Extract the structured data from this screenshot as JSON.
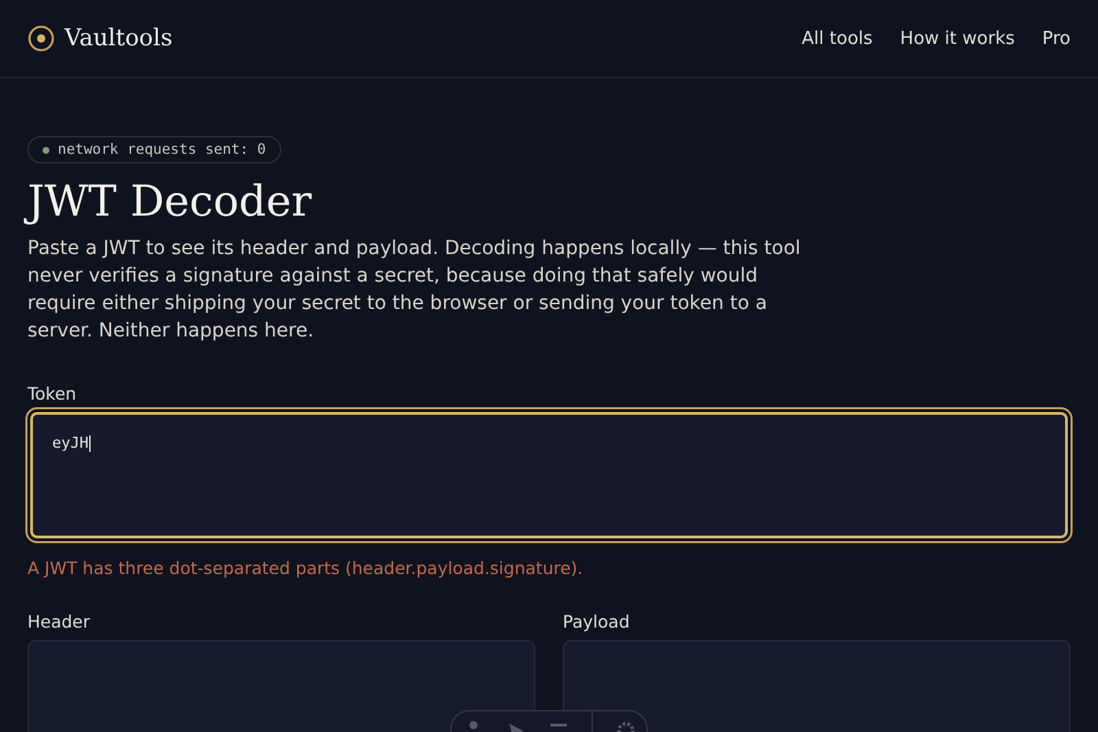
{
  "brand": {
    "name": "Vaultools"
  },
  "nav": [
    "All tools",
    "How it works",
    "Pro"
  ],
  "badge": {
    "text": "network requests sent: 0"
  },
  "title": "JWT Decoder",
  "intro": "Paste a JWT to see its header and payload. Decoding happens locally — this tool never verifies a signature against a secret, because doing that safely would require either shipping your secret to the browser or sending your token to a server. Neither happens here.",
  "token": {
    "label": "Token",
    "value": "eyJH",
    "focused": true
  },
  "error": "A JWT has three dot-separated parts (header.payload.signature).",
  "panels": [
    {
      "label": "Header"
    },
    {
      "label": "Payload"
    }
  ]
}
